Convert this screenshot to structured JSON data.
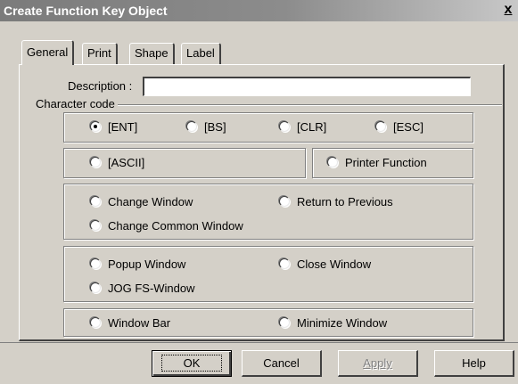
{
  "window": {
    "title": "Create Function Key Object",
    "close_label": "x"
  },
  "tabs": [
    {
      "label": "General",
      "active": true
    },
    {
      "label": "Print",
      "active": false
    },
    {
      "label": "Shape",
      "active": false
    },
    {
      "label": "Label",
      "active": false
    }
  ],
  "description": {
    "label": "Description :",
    "value": ""
  },
  "character_code": {
    "label": "Character code",
    "row1": [
      {
        "label": "[ENT]",
        "selected": true
      },
      {
        "label": "[BS]",
        "selected": false
      },
      {
        "label": "[CLR]",
        "selected": false
      },
      {
        "label": "[ESC]",
        "selected": false
      }
    ],
    "ascii": {
      "label": "[ASCII]",
      "selected": false
    },
    "printer_function": {
      "label": "Printer Function",
      "selected": false
    },
    "change_window": {
      "label": "Change Window",
      "selected": false
    },
    "return_to_previous": {
      "label": "Return to Previous",
      "selected": false
    },
    "change_common_window": {
      "label": "Change Common Window",
      "selected": false
    },
    "popup_window": {
      "label": "Popup Window",
      "selected": false
    },
    "close_window": {
      "label": "Close Window",
      "selected": false
    },
    "jog_fs_window": {
      "label": "JOG FS-Window",
      "selected": false
    },
    "window_bar": {
      "label": "Window Bar",
      "selected": false
    },
    "minimize_window": {
      "label": "Minimize Window",
      "selected": false
    }
  },
  "buttons": {
    "ok": "OK",
    "cancel": "Cancel",
    "apply": "Apply",
    "help": "Help"
  }
}
